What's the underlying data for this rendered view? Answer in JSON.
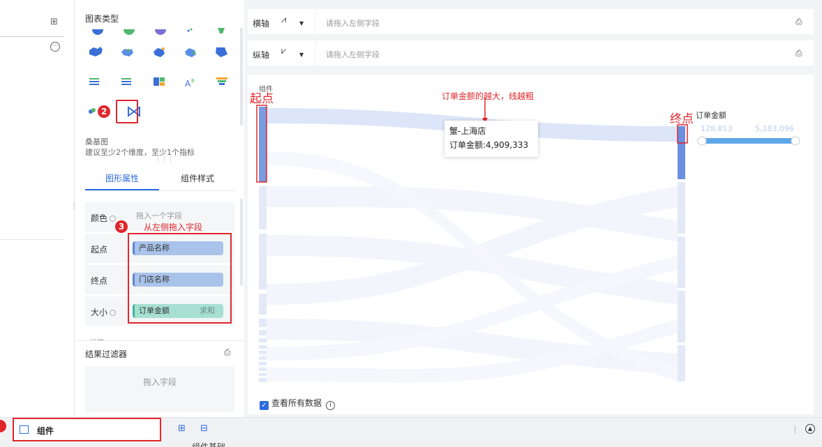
{
  "config": {
    "chart_type_title": "图表类型",
    "sankey_name": "桑基图",
    "sankey_tip": "建议至少2个维度，至少1个指标",
    "tabs": [
      "图形属性",
      "组件样式"
    ],
    "props": {
      "color_label": "颜色",
      "color_placeholder": "拖入一个字段",
      "start_label": "起点",
      "start_field": "产品名称",
      "end_label": "终点",
      "end_field": "门店名称",
      "size_label": "大小",
      "size_field": "订单金额",
      "size_agg": "求和",
      "cut_label": "标签"
    },
    "badges": {
      "b2": "2",
      "b3": "3"
    },
    "annotation_drag": "从左侧拖入字段",
    "filter_title": "结果过滤器",
    "filter_placeholder": "拖入字段"
  },
  "axes": {
    "x_label": "横轴",
    "y_label": "纵轴",
    "placeholder": "请拖入左侧字段"
  },
  "canvas": {
    "title": "组件",
    "annotation_start": "起点",
    "annotation_end": "终点",
    "annotation_width": "订单金额的越大，线越粗",
    "tooltip_line1": "蟹-上海店",
    "tooltip_line2": "订单金额:4,909,333",
    "legend_title": "订单金额",
    "legend_min": "128,813",
    "legend_max": "5,183,096",
    "check_label": "查看所有数据",
    "accent": "#2e6bde",
    "annotation_color": "#e0262b"
  },
  "bottom": {
    "component_tab": "组件",
    "below_text": "组件基础"
  }
}
